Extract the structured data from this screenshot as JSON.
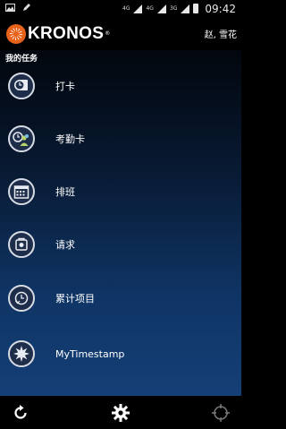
{
  "status_bar": {
    "network_1": "4G",
    "network_2": "4G",
    "network_3": "3G",
    "time": "09:42",
    "icons": [
      "image-icon",
      "edit-icon",
      "signal-icon",
      "battery-icon"
    ]
  },
  "header": {
    "logo_text": "KRONOS",
    "user_name": "赵, 雪花"
  },
  "main": {
    "section_title": "我的任务",
    "items": [
      {
        "label": "打卡",
        "icon": "punch-clock-icon"
      },
      {
        "label": "考勤卡",
        "icon": "timecard-icon"
      },
      {
        "label": "排班",
        "icon": "calendar-icon"
      },
      {
        "label": "请求",
        "icon": "request-icon"
      },
      {
        "label": "累计项目",
        "icon": "accrual-icon"
      },
      {
        "label": "MyTimestamp",
        "icon": "timestamp-icon"
      }
    ]
  },
  "bottom_bar": {
    "icons": [
      "refresh-icon",
      "settings-icon",
      "navigation-icon"
    ]
  },
  "colors": {
    "logo_orange": "#e8621a",
    "gradient_top": "#02060d",
    "gradient_bottom": "#143f76"
  }
}
